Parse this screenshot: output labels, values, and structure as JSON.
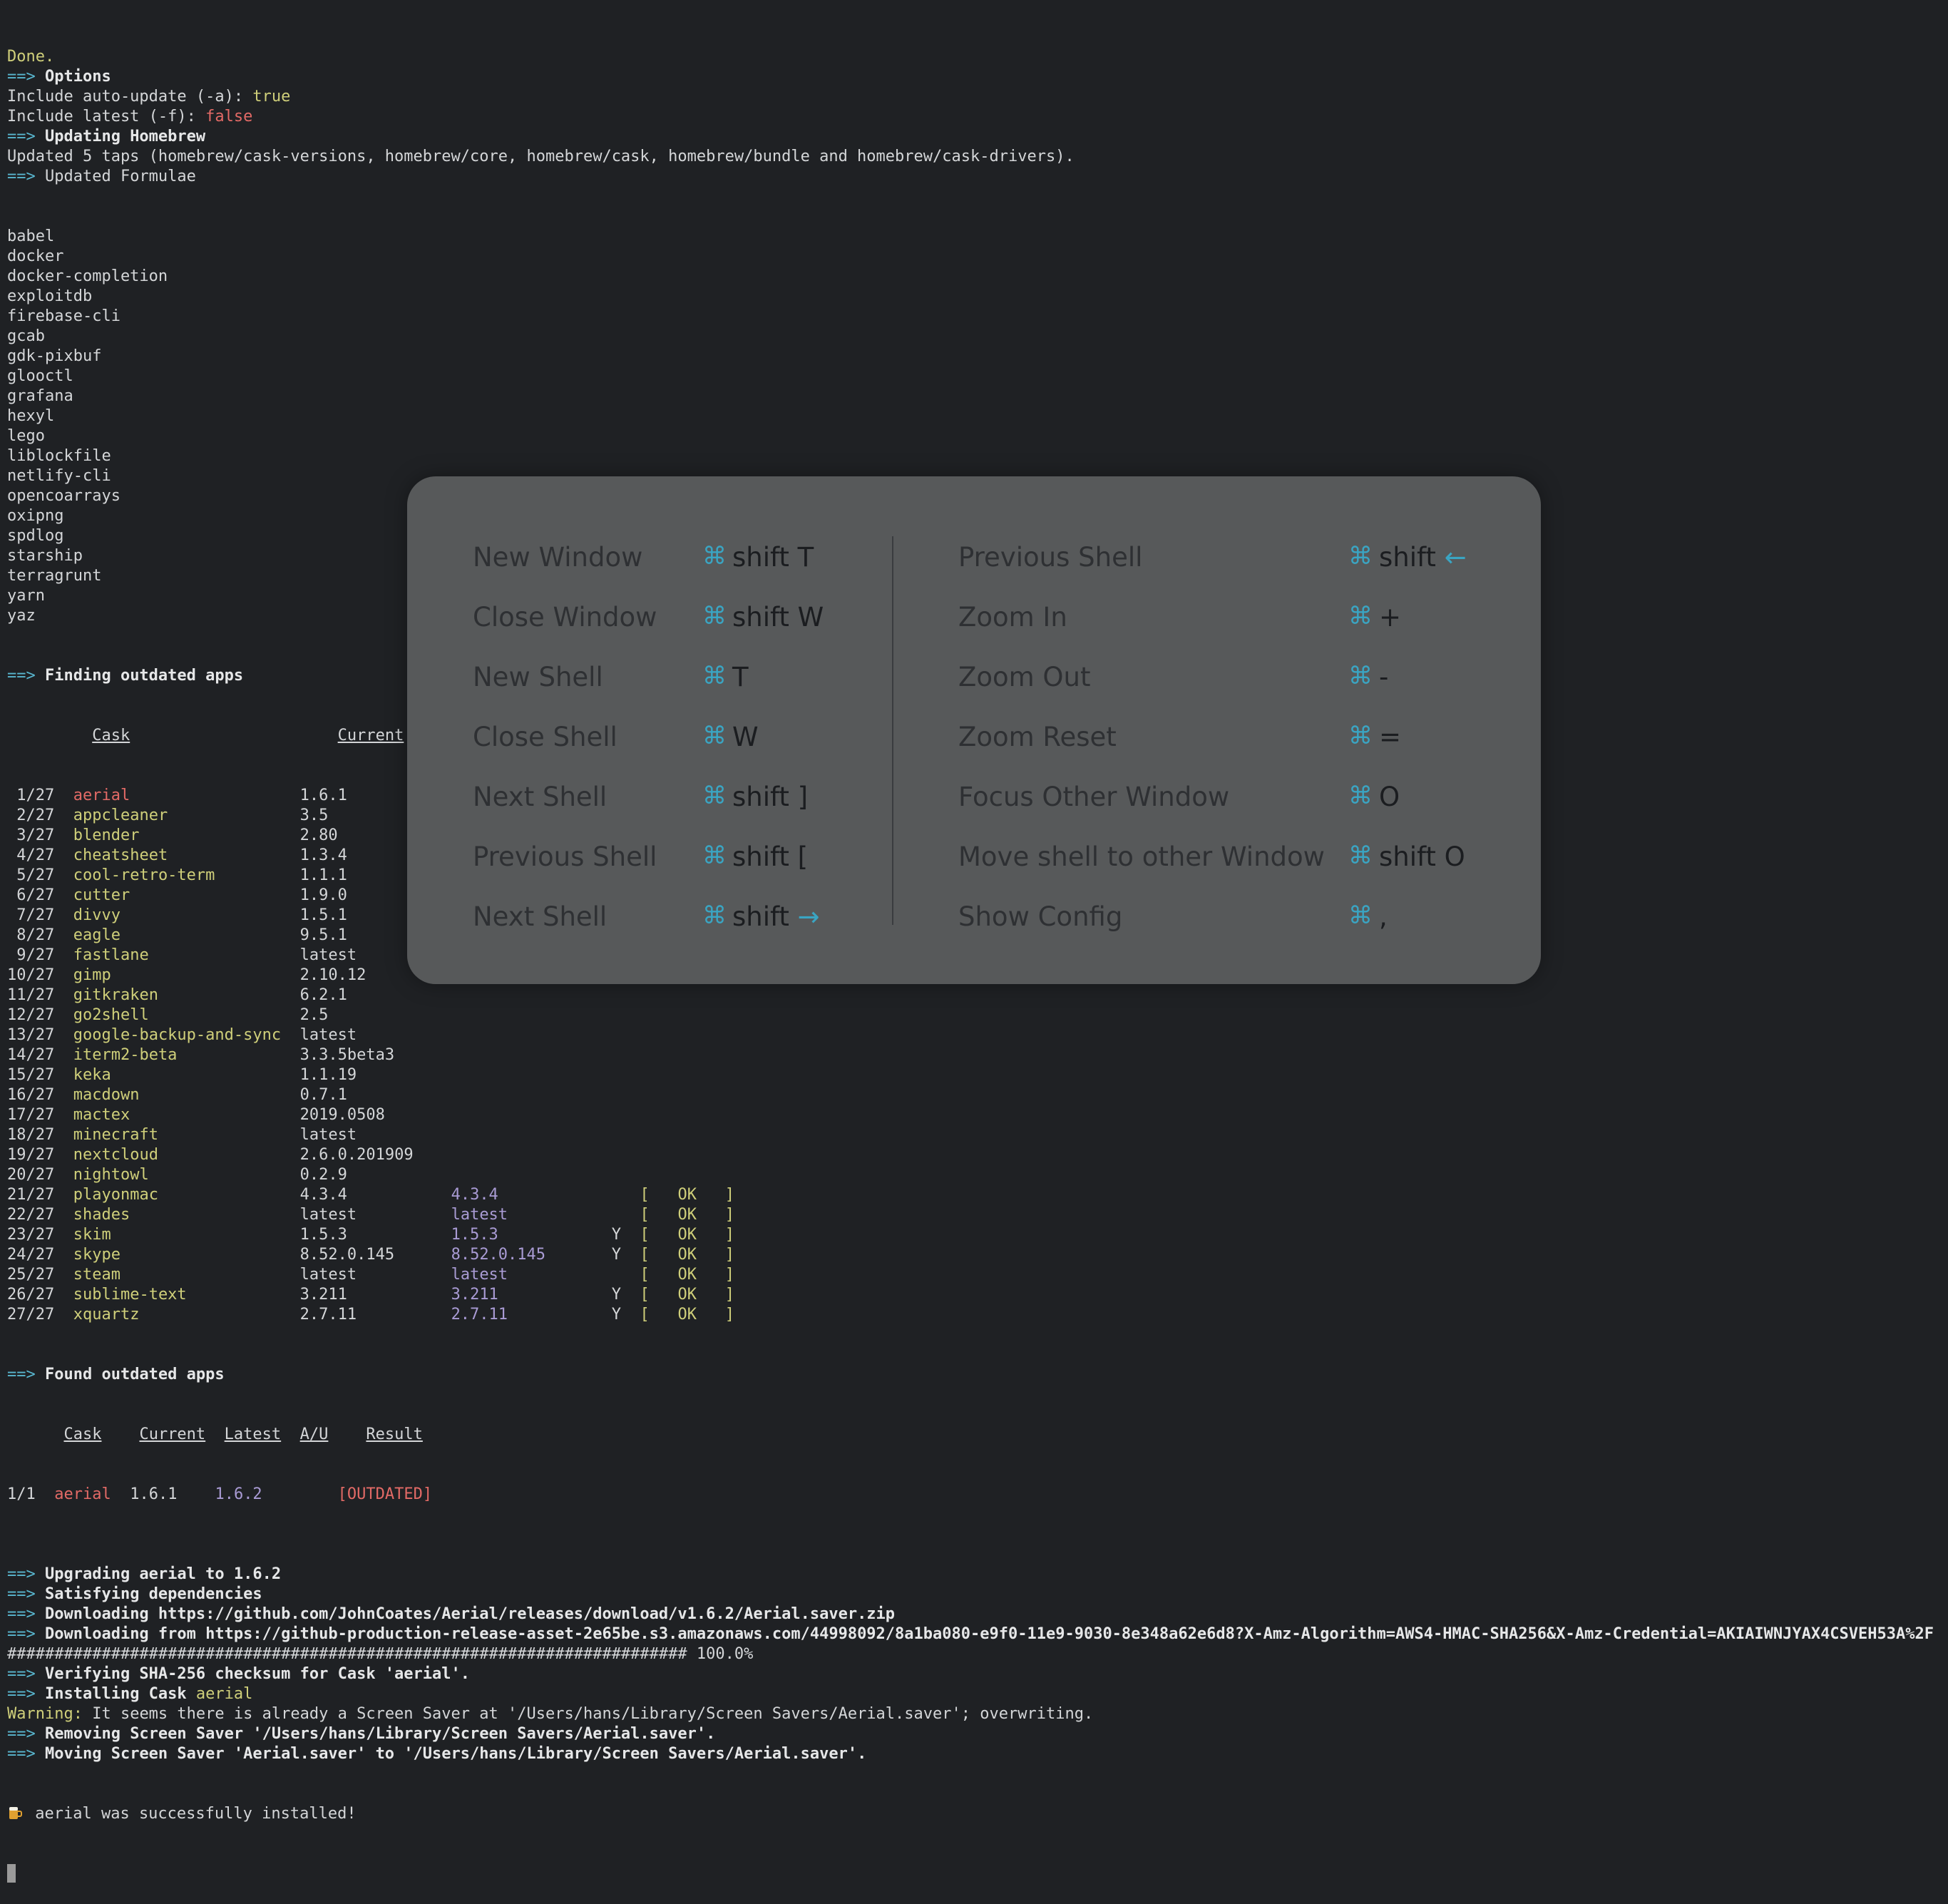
{
  "terminal": {
    "header_lines": [
      {
        "spans": [
          {
            "t": "Done.",
            "c": "c-yellow"
          }
        ]
      },
      {
        "spans": [
          {
            "t": "==> ",
            "c": "c-arrow"
          },
          {
            "t": "Options",
            "c": "c-bold"
          }
        ]
      },
      {
        "spans": [
          {
            "t": "Include auto-update (-a): ",
            "c": ""
          },
          {
            "t": "true",
            "c": "c-yellow"
          }
        ]
      },
      {
        "spans": [
          {
            "t": "Include latest (-f): ",
            "c": ""
          },
          {
            "t": "false",
            "c": "c-red"
          }
        ]
      },
      {
        "spans": [
          {
            "t": "==> ",
            "c": "c-arrow"
          },
          {
            "t": "Updating Homebrew",
            "c": "c-bold"
          }
        ]
      },
      {
        "spans": [
          {
            "t": "Updated 5 taps (homebrew/cask-versions, homebrew/core, homebrew/cask, homebrew/bundle and homebrew/cask-drivers).",
            "c": ""
          }
        ]
      },
      {
        "spans": [
          {
            "t": "==> ",
            "c": "c-arrow"
          },
          {
            "t": "Updated Formulae",
            "c": ""
          }
        ]
      }
    ],
    "formulae": [
      "babel",
      "docker",
      "docker-completion",
      "exploitdb",
      "firebase-cli",
      "gcab",
      "gdk-pixbuf",
      "glooctl",
      "grafana",
      "hexyl",
      "lego",
      "liblockfile",
      "netlify-cli",
      "opencoarrays",
      "oxipng",
      "spdlog",
      "starship",
      "terragrunt",
      "yarn",
      "yaz"
    ],
    "finding_header": "Finding outdated apps",
    "table_headers": {
      "cask": "Cask",
      "current": "Current"
    },
    "casks": [
      {
        "n": " 1/27",
        "name": "aerial",
        "cur": "1.6.1",
        "latest": "",
        "au": "",
        "res": "",
        "red": true
      },
      {
        "n": " 2/27",
        "name": "appcleaner",
        "cur": "3.5",
        "latest": "",
        "au": "",
        "res": ""
      },
      {
        "n": " 3/27",
        "name": "blender",
        "cur": "2.80",
        "latest": "",
        "au": "",
        "res": ""
      },
      {
        "n": " 4/27",
        "name": "cheatsheet",
        "cur": "1.3.4",
        "latest": "",
        "au": "",
        "res": ""
      },
      {
        "n": " 5/27",
        "name": "cool-retro-term",
        "cur": "1.1.1",
        "latest": "",
        "au": "",
        "res": ""
      },
      {
        "n": " 6/27",
        "name": "cutter",
        "cur": "1.9.0",
        "latest": "",
        "au": "",
        "res": ""
      },
      {
        "n": " 7/27",
        "name": "divvy",
        "cur": "1.5.1",
        "latest": "",
        "au": "",
        "res": ""
      },
      {
        "n": " 8/27",
        "name": "eagle",
        "cur": "9.5.1",
        "latest": "",
        "au": "",
        "res": ""
      },
      {
        "n": " 9/27",
        "name": "fastlane",
        "cur": "latest",
        "latest": "",
        "au": "",
        "res": ""
      },
      {
        "n": "10/27",
        "name": "gimp",
        "cur": "2.10.12",
        "latest": "",
        "au": "",
        "res": ""
      },
      {
        "n": "11/27",
        "name": "gitkraken",
        "cur": "6.2.1",
        "latest": "",
        "au": "",
        "res": ""
      },
      {
        "n": "12/27",
        "name": "go2shell",
        "cur": "2.5",
        "latest": "",
        "au": "",
        "res": ""
      },
      {
        "n": "13/27",
        "name": "google-backup-and-sync",
        "cur": "latest",
        "latest": "",
        "au": "",
        "res": ""
      },
      {
        "n": "14/27",
        "name": "iterm2-beta",
        "cur": "3.3.5beta3",
        "latest": "",
        "au": "",
        "res": ""
      },
      {
        "n": "15/27",
        "name": "keka",
        "cur": "1.1.19",
        "latest": "",
        "au": "",
        "res": ""
      },
      {
        "n": "16/27",
        "name": "macdown",
        "cur": "0.7.1",
        "latest": "",
        "au": "",
        "res": ""
      },
      {
        "n": "17/27",
        "name": "mactex",
        "cur": "2019.0508",
        "latest": "",
        "au": "",
        "res": ""
      },
      {
        "n": "18/27",
        "name": "minecraft",
        "cur": "latest",
        "latest": "",
        "au": "",
        "res": ""
      },
      {
        "n": "19/27",
        "name": "nextcloud",
        "cur": "2.6.0.201909",
        "latest": "",
        "au": "",
        "res": ""
      },
      {
        "n": "20/27",
        "name": "nightowl",
        "cur": "0.2.9",
        "latest": "",
        "au": "",
        "res": ""
      },
      {
        "n": "21/27",
        "name": "playonmac",
        "cur": "4.3.4",
        "latest": "4.3.4",
        "au": " ",
        "res": "[   OK   ]"
      },
      {
        "n": "22/27",
        "name": "shades",
        "cur": "latest",
        "latest": "latest",
        "au": " ",
        "res": "[   OK   ]"
      },
      {
        "n": "23/27",
        "name": "skim",
        "cur": "1.5.3",
        "latest": "1.5.3",
        "au": "Y",
        "res": "[   OK   ]"
      },
      {
        "n": "24/27",
        "name": "skype",
        "cur": "8.52.0.145",
        "latest": "8.52.0.145",
        "au": "Y",
        "res": "[   OK   ]"
      },
      {
        "n": "25/27",
        "name": "steam",
        "cur": "latest",
        "latest": "latest",
        "au": " ",
        "res": "[   OK   ]"
      },
      {
        "n": "26/27",
        "name": "sublime-text",
        "cur": "3.211",
        "latest": "3.211",
        "au": "Y",
        "res": "[   OK   ]"
      },
      {
        "n": "27/27",
        "name": "xquartz",
        "cur": "2.7.11",
        "latest": "2.7.11",
        "au": "Y",
        "res": "[   OK   ]"
      }
    ],
    "found_header": "Found outdated apps",
    "found_table": {
      "headers": [
        "Cask",
        "Current",
        "Latest",
        "A/U",
        "Result"
      ],
      "row": {
        "n": "1/1",
        "name": "aerial",
        "cur": "1.6.1",
        "latest": "1.6.2",
        "res": "[OUTDATED]"
      }
    },
    "footer_lines": [
      {
        "spans": [
          {
            "t": "",
            "c": ""
          }
        ]
      },
      {
        "spans": [
          {
            "t": "==> ",
            "c": "c-arrow"
          },
          {
            "t": "Upgrading aerial to 1.6.2",
            "c": "c-bold"
          }
        ]
      },
      {
        "spans": [
          {
            "t": "==> ",
            "c": "c-arrow"
          },
          {
            "t": "Satisfying dependencies",
            "c": "c-bold"
          }
        ]
      },
      {
        "spans": [
          {
            "t": "==> ",
            "c": "c-arrow"
          },
          {
            "t": "Downloading https://github.com/JohnCoates/Aerial/releases/download/v1.6.2/Aerial.saver.zip",
            "c": "c-bold"
          }
        ]
      },
      {
        "spans": [
          {
            "t": "==> ",
            "c": "c-arrow"
          },
          {
            "t": "Downloading from https://github-production-release-asset-2e65be.s3.amazonaws.com/44998092/8a1ba080-e9f0-11e9-9030-8e348a62e6d8?X-Amz-Algorithm=AWS4-HMAC-SHA256&X-Amz-Credential=AKIAIWNJYAX4CSVEH53A%2F",
            "c": "c-bold"
          }
        ]
      },
      {
        "spans": [
          {
            "t": "######################################################################## 100.0%",
            "c": ""
          }
        ]
      },
      {
        "spans": [
          {
            "t": "==> ",
            "c": "c-arrow"
          },
          {
            "t": "Verifying SHA-256 checksum for Cask 'aerial'.",
            "c": "c-bold"
          }
        ]
      },
      {
        "spans": [
          {
            "t": "==> ",
            "c": "c-arrow"
          },
          {
            "t": "Installing Cask ",
            "c": "c-bold"
          },
          {
            "t": "aerial",
            "c": "c-yellow"
          }
        ]
      },
      {
        "spans": [
          {
            "t": "Warning:",
            "c": "c-yellow"
          },
          {
            "t": " It seems there is already a Screen Saver at '/Users/hans/Library/Screen Savers/Aerial.saver'; overwriting.",
            "c": ""
          }
        ]
      },
      {
        "spans": [
          {
            "t": "==> ",
            "c": "c-arrow"
          },
          {
            "t": "Removing Screen Saver '/Users/hans/Library/Screen Savers/Aerial.saver'.",
            "c": "c-bold"
          }
        ]
      },
      {
        "spans": [
          {
            "t": "==> ",
            "c": "c-arrow"
          },
          {
            "t": "Moving Screen Saver 'Aerial.saver' to '/Users/hans/Library/Screen Savers/Aerial.saver'.",
            "c": "c-bold"
          }
        ]
      }
    ],
    "success_text": " aerial was successfully installed!"
  },
  "shortcuts": {
    "cmd_glyph": "⌘",
    "left": [
      {
        "label": "New Window",
        "keys": "shift T",
        "arrow": ""
      },
      {
        "label": "Close Window",
        "keys": "shift W",
        "arrow": ""
      },
      {
        "label": "New Shell",
        "keys": "T",
        "arrow": ""
      },
      {
        "label": "Close Shell",
        "keys": "W",
        "arrow": ""
      },
      {
        "label": "Next Shell",
        "keys": "shift ]",
        "arrow": ""
      },
      {
        "label": "Previous Shell",
        "keys": "shift [",
        "arrow": ""
      },
      {
        "label": "Next Shell",
        "keys": "shift ",
        "arrow": "→"
      }
    ],
    "right": [
      {
        "label": "Previous Shell",
        "keys": "shift ",
        "arrow": "←"
      },
      {
        "label": "Zoom In",
        "keys": "+",
        "arrow": ""
      },
      {
        "label": "Zoom Out",
        "keys": "-",
        "arrow": ""
      },
      {
        "label": "Zoom Reset",
        "keys": "=",
        "arrow": ""
      },
      {
        "label": "Focus Other Window",
        "keys": "O",
        "arrow": ""
      },
      {
        "label": "Move shell to other Window",
        "keys": "shift O",
        "arrow": ""
      },
      {
        "label": "Show Config",
        "keys": ",",
        "arrow": ""
      }
    ]
  }
}
